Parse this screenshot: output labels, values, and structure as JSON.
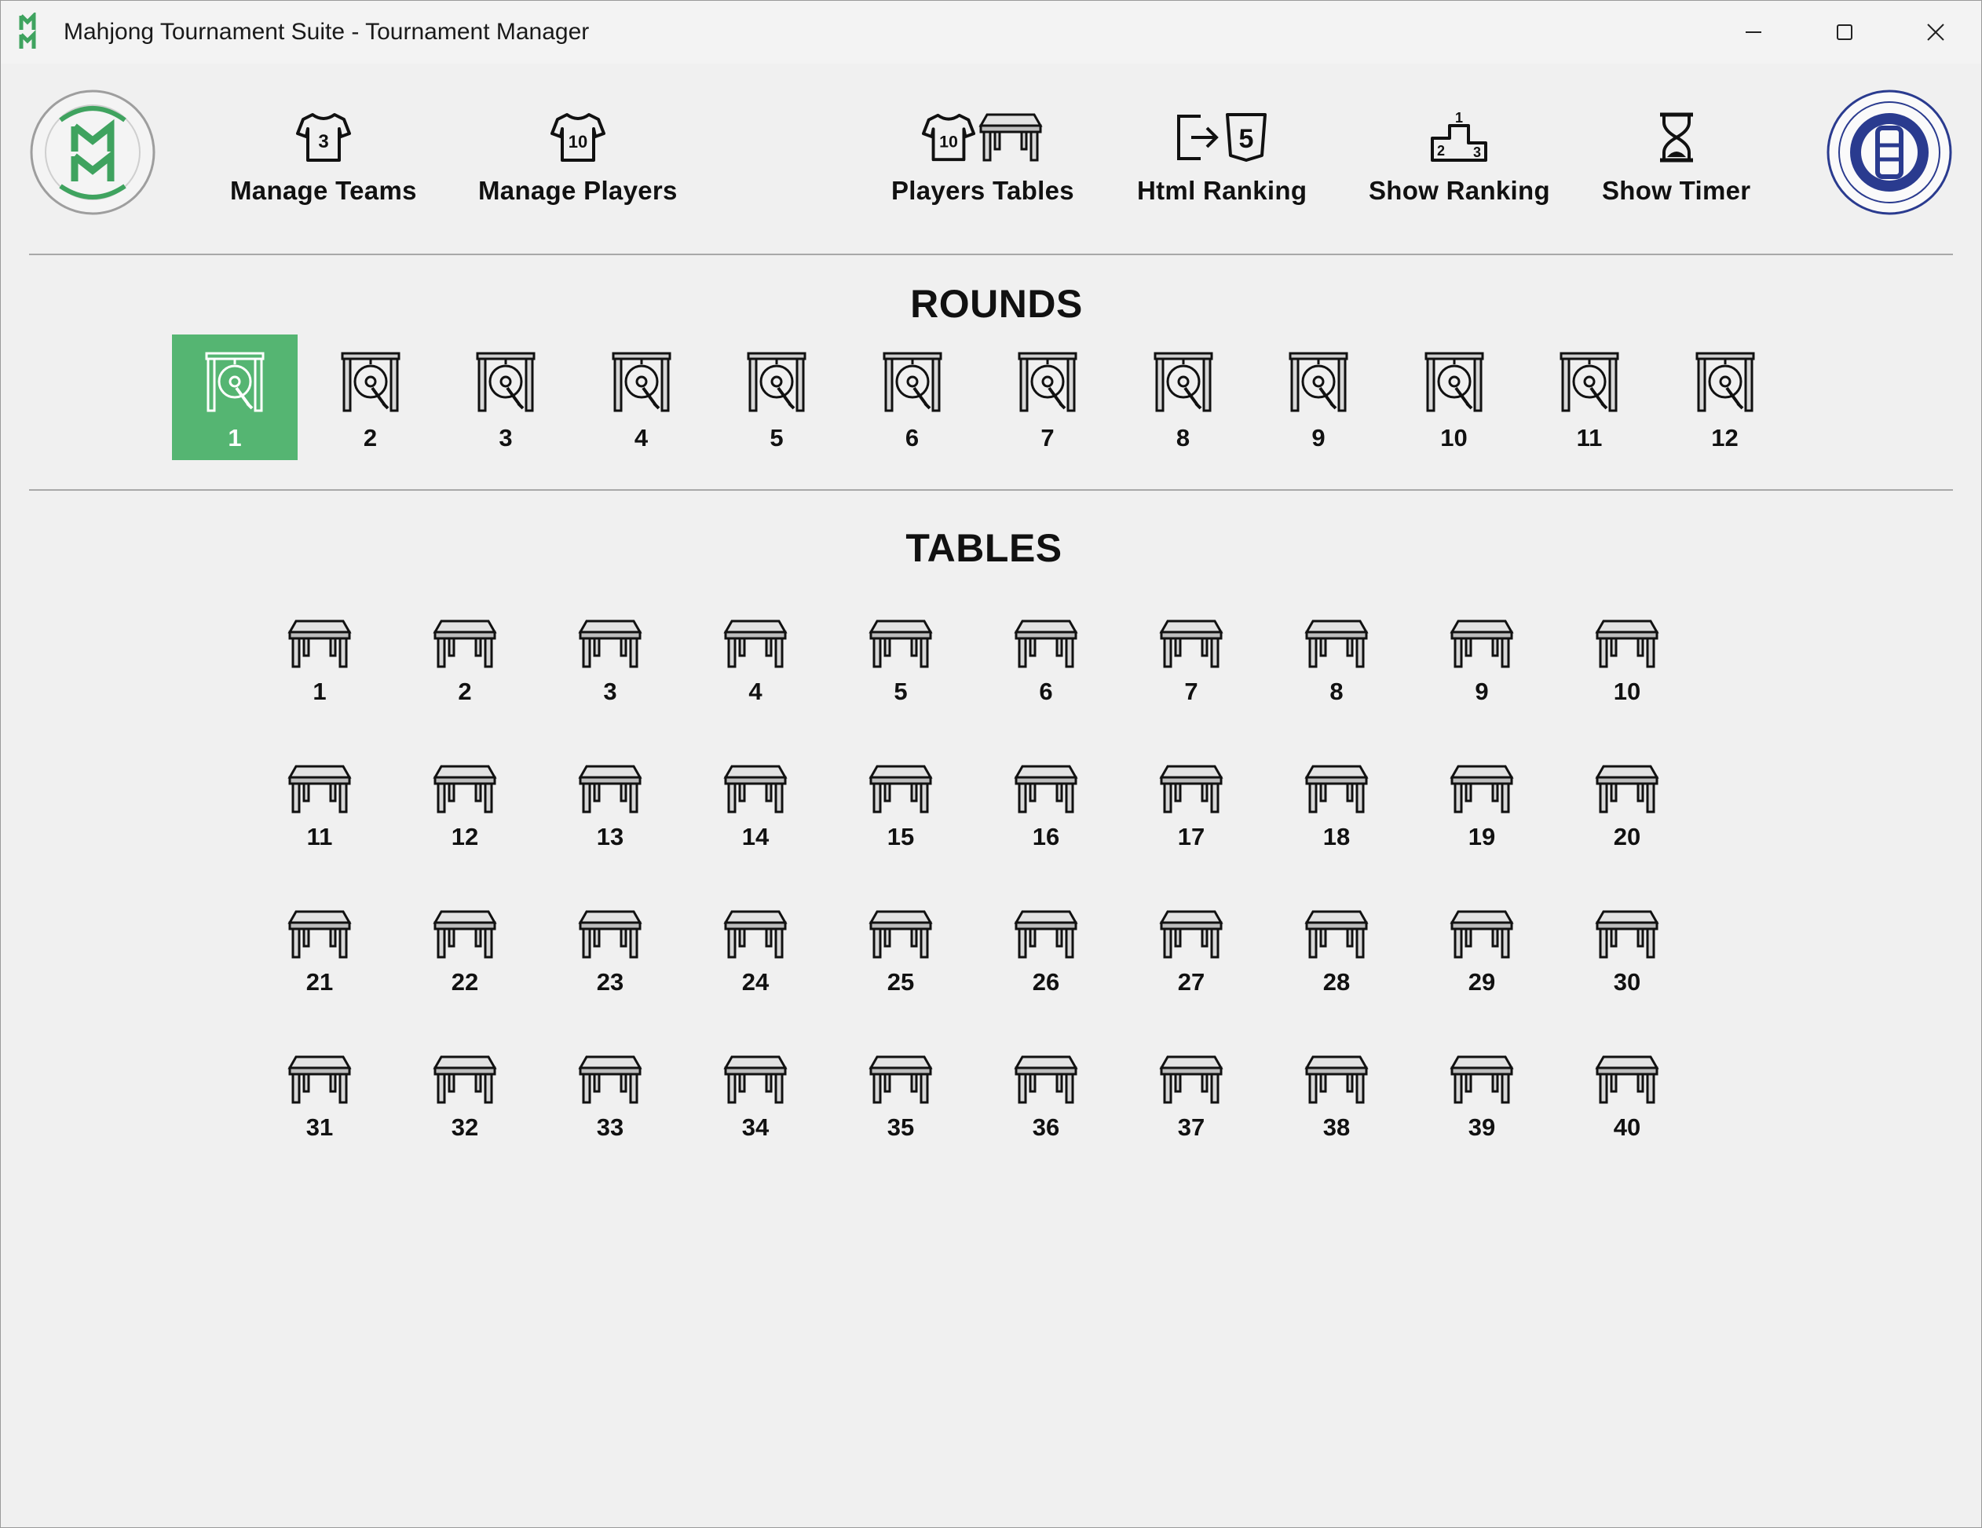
{
  "window": {
    "title": "Mahjong Tournament Suite - Tournament Manager",
    "minimize_icon": "minimize-icon",
    "maximize_icon": "maximize-icon",
    "close_icon": "close-icon"
  },
  "toolbar": {
    "manage_teams": "Manage Teams",
    "manage_players": "Manage Players",
    "players_tables": "Players Tables",
    "html_ranking": "Html Ranking",
    "show_ranking": "Show Ranking",
    "show_timer": "Show Timer",
    "teams_icon_number": "3",
    "players_icon_number": "10",
    "players_tables_icon_number": "10",
    "html_icon_number": "5",
    "podium_numbers": [
      "2",
      "1",
      "3"
    ]
  },
  "rounds": {
    "title": "ROUNDS",
    "selected": "1",
    "items": [
      "1",
      "2",
      "3",
      "4",
      "5",
      "6",
      "7",
      "8",
      "9",
      "10",
      "11",
      "12"
    ]
  },
  "tables": {
    "title": "TABLES",
    "items": [
      "1",
      "2",
      "3",
      "4",
      "5",
      "6",
      "7",
      "8",
      "9",
      "10",
      "11",
      "12",
      "13",
      "14",
      "15",
      "16",
      "17",
      "18",
      "19",
      "20",
      "21",
      "22",
      "23",
      "24",
      "25",
      "26",
      "27",
      "28",
      "29",
      "30",
      "31",
      "32",
      "33",
      "34",
      "35",
      "36",
      "37",
      "38",
      "39",
      "40"
    ]
  },
  "colors": {
    "selected_round": "#55b572",
    "logo_green": "#3fa35f",
    "ema_blue": "#2a3b8f"
  }
}
